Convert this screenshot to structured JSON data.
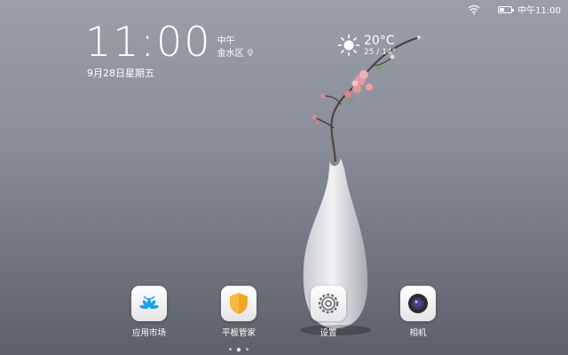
{
  "status_bar": {
    "time_text": "中午11:00",
    "battery_level": 0.4
  },
  "clock": {
    "time": "11:00",
    "period": "中午",
    "location": "金水区",
    "date": "9月28日星期五"
  },
  "weather": {
    "temperature": "20°C",
    "range": "25 / 14°"
  },
  "dock": {
    "apps": [
      {
        "label": "应用市场"
      },
      {
        "label": "平板管家"
      },
      {
        "label": "设置"
      },
      {
        "label": "相机"
      }
    ]
  },
  "page_indicator": {
    "count": 3,
    "current": 2
  }
}
